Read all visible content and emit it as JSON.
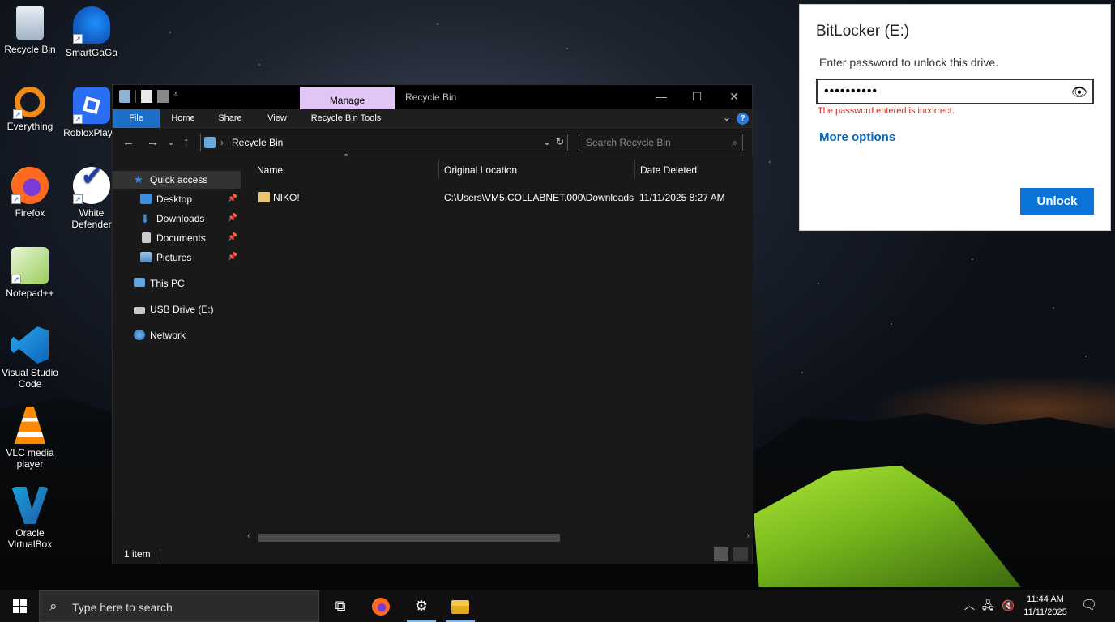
{
  "desktop": {
    "icons": [
      {
        "label": "Recycle Bin"
      },
      {
        "label": "SmartGaGa"
      },
      {
        "label": "Everything"
      },
      {
        "label": "RobloxPlay..."
      },
      {
        "label": "Firefox"
      },
      {
        "label": "White Defender"
      },
      {
        "label": "Notepad++"
      },
      {
        "label": "Visual Studio Code"
      },
      {
        "label": "VLC media player"
      },
      {
        "label": "Oracle VirtualBox"
      }
    ]
  },
  "explorer": {
    "manage_tab": "Manage",
    "title": "Recycle Bin",
    "ribbon_tabs": [
      "File",
      "Home",
      "Share",
      "View",
      "Recycle Bin Tools"
    ],
    "address": "Recycle Bin",
    "search_placeholder": "Search Recycle Bin",
    "nav": {
      "quick_access": "Quick access",
      "items": [
        "Desktop",
        "Downloads",
        "Documents",
        "Pictures"
      ],
      "this_pc": "This PC",
      "usb": "USB Drive (E:)",
      "network": "Network"
    },
    "columns": [
      "Name",
      "Original Location",
      "Date Deleted"
    ],
    "rows": [
      {
        "name": "NIKO!",
        "location": "C:\\Users\\VM5.COLLABNET.000\\Downloads",
        "date": "11/11/2025 8:27 AM"
      }
    ],
    "status": "1 item"
  },
  "bitlocker": {
    "title": "BitLocker (E:)",
    "prompt": "Enter password to unlock this drive.",
    "password_value": "••••••••••",
    "error": "The password entered is incorrect.",
    "more_options": "More options",
    "unlock": "Unlock"
  },
  "taskbar": {
    "search_placeholder": "Type here to search",
    "time": "11:44 AM",
    "date": "11/11/2025"
  },
  "colors": {
    "accent": "#0a74d9",
    "error": "#c42b1c",
    "link": "#0067c0",
    "manage_tab": "#e0c6f5",
    "file_tab": "#1e6fc8"
  }
}
